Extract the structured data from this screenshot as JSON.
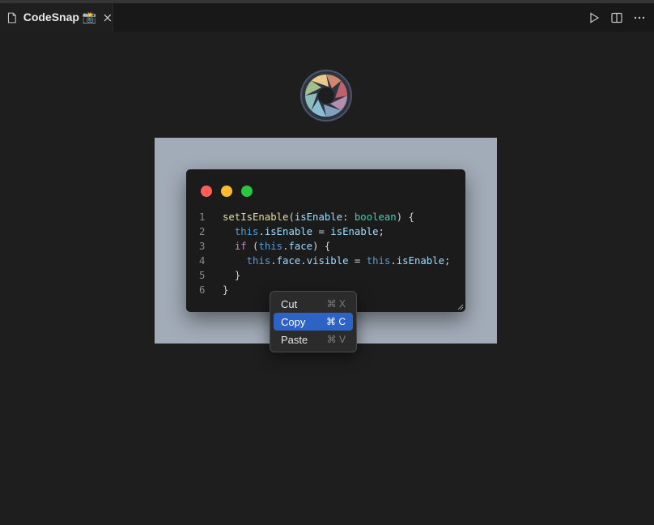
{
  "tab": {
    "title": "CodeSnap 📸",
    "icons": {
      "file": "file-icon",
      "close": "close-icon"
    }
  },
  "toolbar": {
    "icons": [
      "run-icon",
      "split-editor-icon",
      "more-actions-icon"
    ]
  },
  "logo": {
    "icon": "codesnap-logo-icon"
  },
  "window_controls": {
    "colors": [
      "#ff5f57",
      "#febc2e",
      "#28c840"
    ]
  },
  "code": {
    "line_numbers": [
      "1",
      "2",
      "3",
      "4",
      "5",
      "6"
    ],
    "lines": [
      {
        "indent": "",
        "tokens": [
          {
            "t": "setIsEnable",
            "c": "fn"
          },
          {
            "t": "(",
            "c": "p"
          },
          {
            "t": "isEnable",
            "c": "var"
          },
          {
            "t": ": ",
            "c": "p"
          },
          {
            "t": "boolean",
            "c": "type"
          },
          {
            "t": ") {",
            "c": "p"
          }
        ]
      },
      {
        "indent": "  ",
        "tokens": [
          {
            "t": "this",
            "c": "kw"
          },
          {
            "t": ".",
            "c": "p"
          },
          {
            "t": "isEnable",
            "c": "var"
          },
          {
            "t": " = ",
            "c": "p"
          },
          {
            "t": "isEnable",
            "c": "var"
          },
          {
            "t": ";",
            "c": "p"
          }
        ]
      },
      {
        "indent": "  ",
        "tokens": [
          {
            "t": "if",
            "c": "ctl"
          },
          {
            "t": " (",
            "c": "p"
          },
          {
            "t": "this",
            "c": "kw"
          },
          {
            "t": ".",
            "c": "p"
          },
          {
            "t": "face",
            "c": "var"
          },
          {
            "t": ") {",
            "c": "p"
          }
        ]
      },
      {
        "indent": "    ",
        "tokens": [
          {
            "t": "this",
            "c": "kw"
          },
          {
            "t": ".",
            "c": "p"
          },
          {
            "t": "face",
            "c": "var"
          },
          {
            "t": ".",
            "c": "p"
          },
          {
            "t": "visible",
            "c": "var"
          },
          {
            "t": " = ",
            "c": "p"
          },
          {
            "t": "this",
            "c": "kw"
          },
          {
            "t": ".",
            "c": "p"
          },
          {
            "t": "isEnable",
            "c": "var"
          },
          {
            "t": ";",
            "c": "p"
          }
        ]
      },
      {
        "indent": "  ",
        "tokens": [
          {
            "t": "}",
            "c": "p"
          }
        ]
      },
      {
        "indent": "",
        "tokens": [
          {
            "t": "}",
            "c": "p"
          }
        ]
      }
    ]
  },
  "context_menu": {
    "items": [
      {
        "label": "Cut",
        "shortcut": "⌘ X",
        "active": false
      },
      {
        "label": "Copy",
        "shortcut": "⌘ C",
        "active": true
      },
      {
        "label": "Paste",
        "shortcut": "⌘ V",
        "active": false
      }
    ]
  },
  "colors": {
    "background": "#1e1e1e",
    "frame": "#a2acb8",
    "menu_highlight": "#2c63c4"
  }
}
